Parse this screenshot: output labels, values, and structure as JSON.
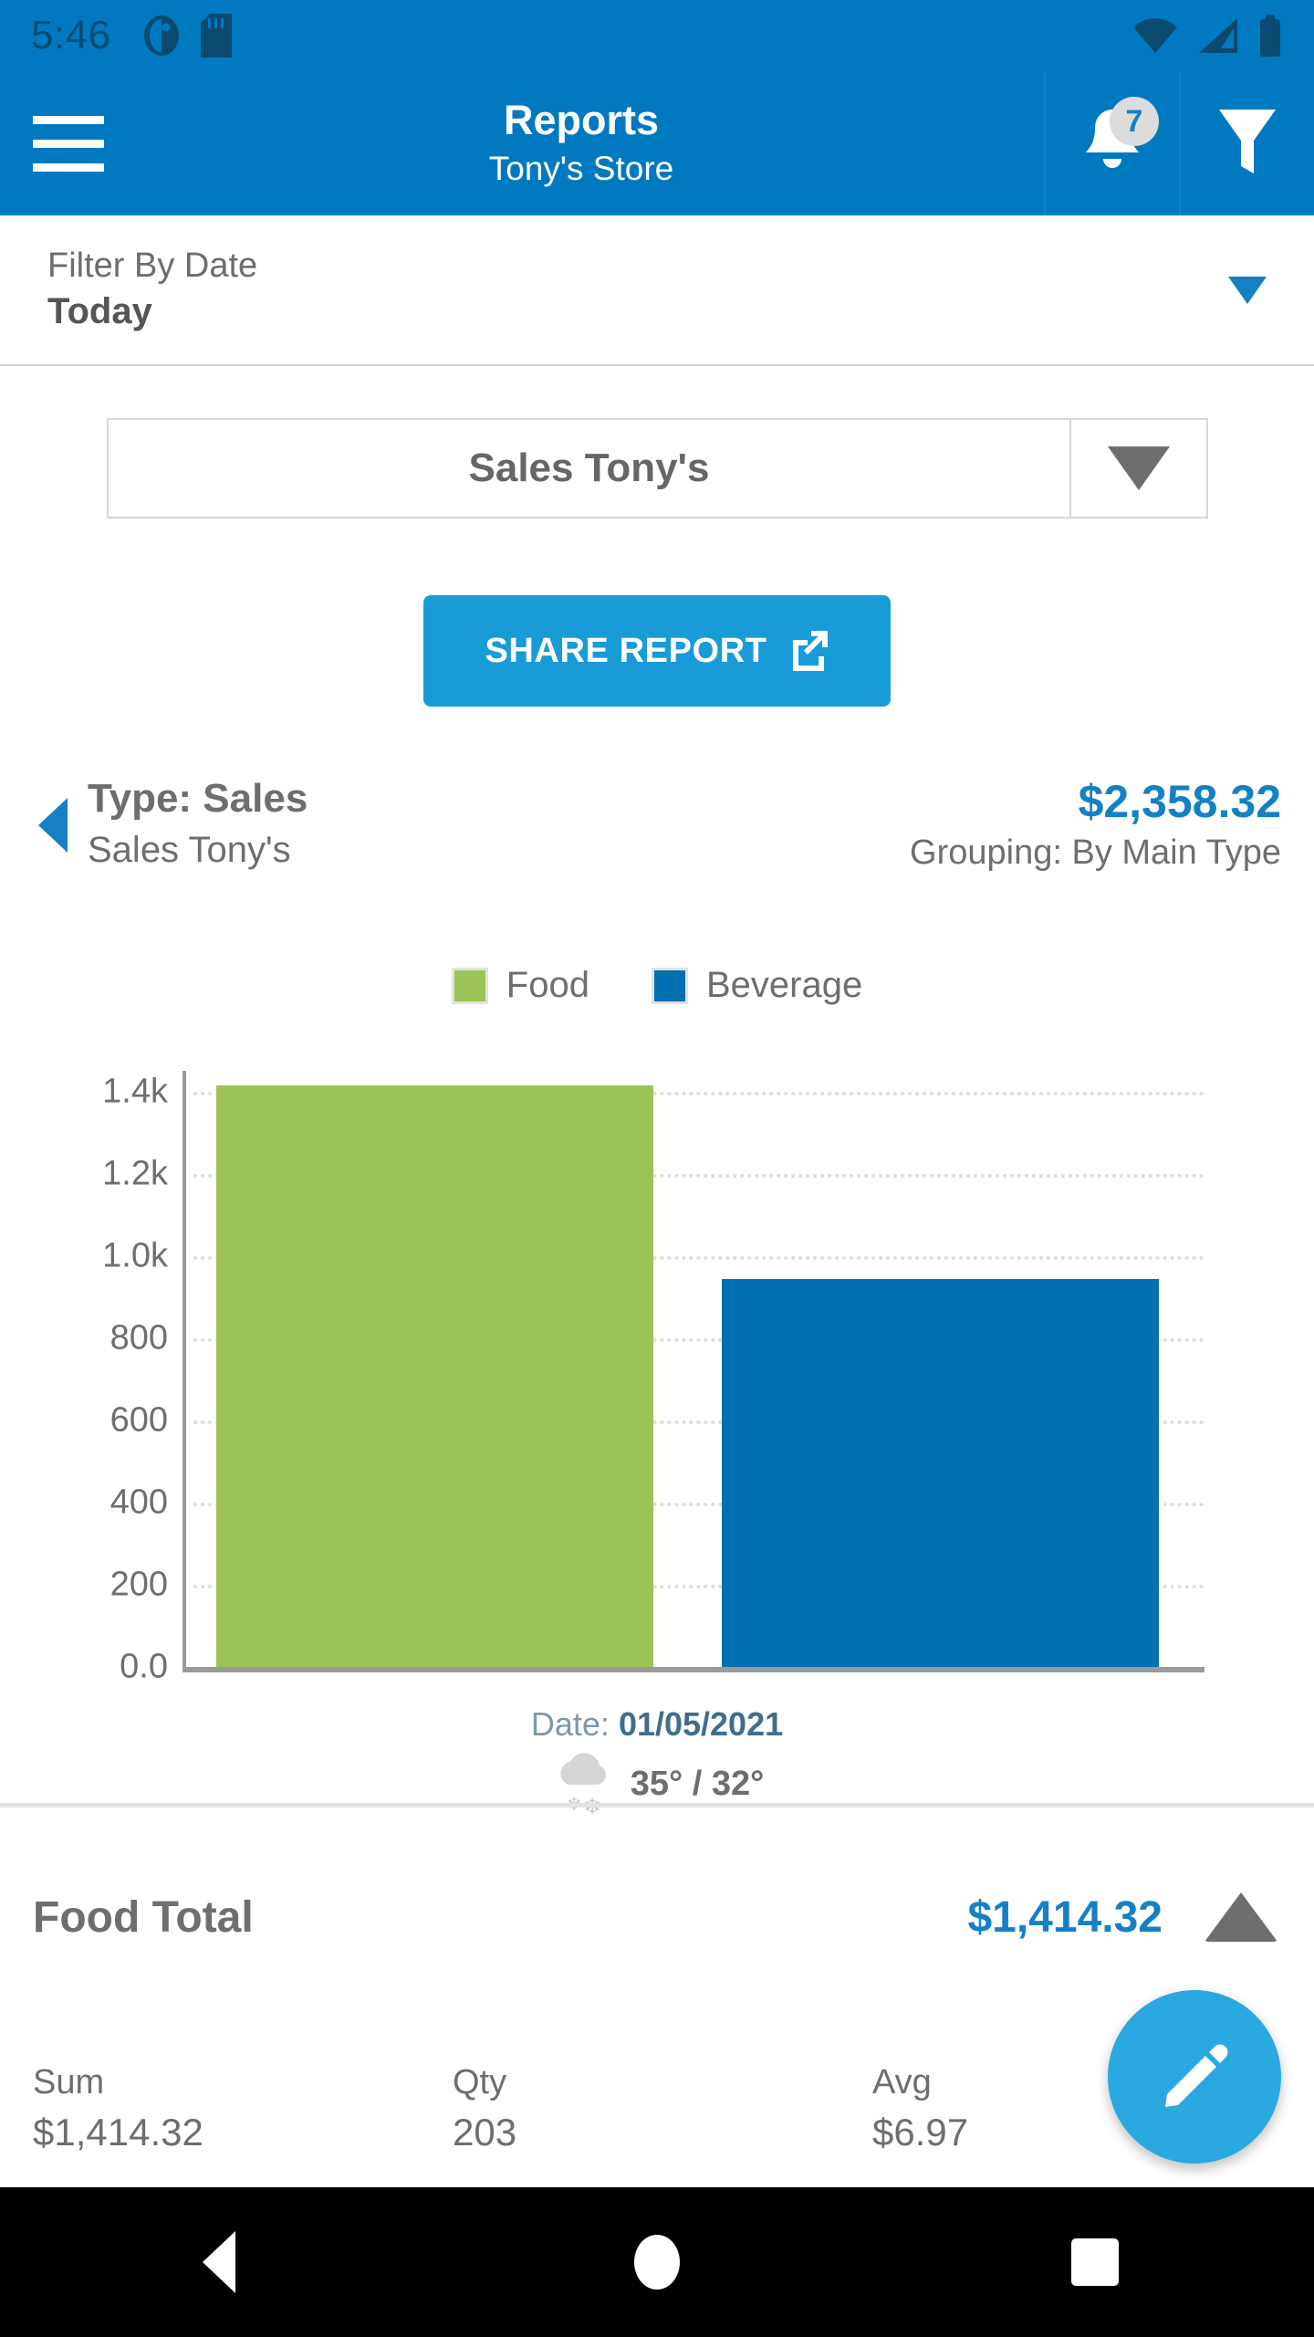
{
  "status_bar": {
    "time": "5:46",
    "icons": [
      "app-notification-icon",
      "sd-card-icon",
      "wifi-icon",
      "cellular-signal-icon",
      "battery-icon"
    ]
  },
  "app_bar": {
    "menu_icon": "hamburger-menu-icon",
    "title": "Reports",
    "subtitle": "Tony's Store",
    "notifications": {
      "icon": "bell-icon",
      "badge_count": "7"
    },
    "filter_icon": "funnel-filter-icon"
  },
  "date_filter": {
    "label": "Filter By Date",
    "value": "Today",
    "dropdown_icon": "chevron-down-icon"
  },
  "report_select": {
    "value": "Sales Tony's",
    "dropdown_icon": "triangle-down-icon"
  },
  "share_button": {
    "label": "SHARE REPORT",
    "icon": "external-link-icon"
  },
  "type_summary": {
    "collapse_icon": "triangle-left-icon",
    "title": "Type: Sales",
    "subtitle": "Sales Tony's",
    "amount": "$2,358.32",
    "grouping": "Grouping: By Main Type"
  },
  "chart_date": {
    "prefix": "Date:",
    "value": "01/05/2021",
    "weather_icon": "cloud-snow-icon",
    "temperature": "35° / 32°"
  },
  "food_total": {
    "label": "Food Total",
    "amount": "$1,414.32",
    "collapse_icon": "triangle-up-icon"
  },
  "stats": [
    {
      "label": "Sum",
      "value": "$1,414.32"
    },
    {
      "label": "Qty",
      "value": "203"
    },
    {
      "label": "Avg",
      "value": "$6.97"
    }
  ],
  "fab": {
    "icon": "pencil-edit-icon"
  },
  "nav_bar": {
    "back": "back-triangle-icon",
    "home": "home-circle-icon",
    "recents": "recents-square-icon"
  },
  "colors": {
    "primary": "#0079C1",
    "accent": "#1581c4",
    "share_button": "#199BD7",
    "fab": "#29A9DF",
    "food": "#9CC356",
    "beverage": "#0070B0",
    "text_gray": "#6e6e6e"
  },
  "chart_data": {
    "type": "bar",
    "title": "",
    "categories": [
      "Food",
      "Beverage"
    ],
    "values": [
      1414.32,
      944.0
    ],
    "series": [
      {
        "name": "Food",
        "values": [
          1414.32
        ],
        "color": "#9CC356"
      },
      {
        "name": "Beverage",
        "values": [
          944.0
        ],
        "color": "#0070B0"
      }
    ],
    "legend": [
      "Food",
      "Beverage"
    ],
    "legend_position": "top",
    "xlabel": "",
    "ylabel": "",
    "ylim": [
      0,
      1450
    ],
    "yticks": [
      0,
      200,
      400,
      600,
      800,
      1000,
      1200,
      1400
    ],
    "ytick_labels": [
      "0.0",
      "200",
      "400",
      "600",
      "800",
      "1.0k",
      "1.2k",
      "1.4k"
    ],
    "grid": true,
    "grid_style": "dotted-horizontal"
  }
}
